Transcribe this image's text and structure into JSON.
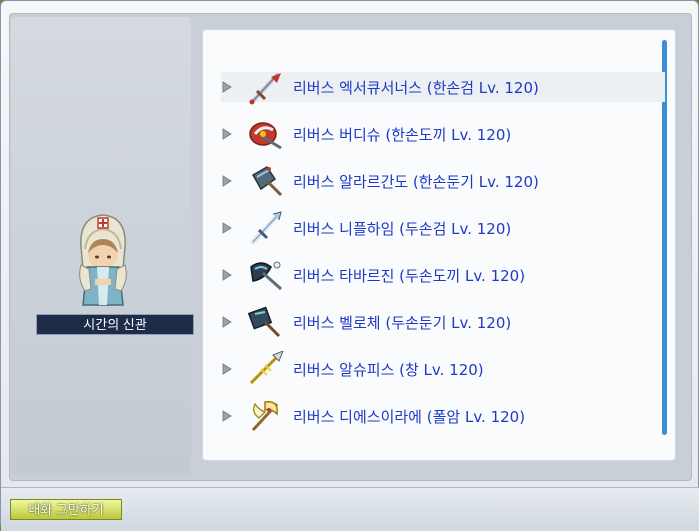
{
  "npc": {
    "name": "시간의 신관",
    "sprite": "hooded-priest-npc"
  },
  "options": [
    {
      "label": "리버스 엑서큐서너스 (한손검 Lv. 120)",
      "icon": "one-handed-sword-icon",
      "highlighted": true
    },
    {
      "label": "리버스 버디슈 (한손도끼 Lv. 120)",
      "icon": "one-handed-axe-icon",
      "highlighted": false
    },
    {
      "label": "리버스 알라르간도 (한손둔기 Lv. 120)",
      "icon": "one-handed-blunt-icon",
      "highlighted": false
    },
    {
      "label": "리버스 니플하임 (두손검 Lv. 120)",
      "icon": "two-handed-sword-icon",
      "highlighted": false
    },
    {
      "label": "리버스 타바르진 (두손도끼 Lv. 120)",
      "icon": "two-handed-axe-icon",
      "highlighted": false
    },
    {
      "label": "리버스 벨로체 (두손둔기 Lv. 120)",
      "icon": "two-handed-blunt-icon",
      "highlighted": false
    },
    {
      "label": "리버스 알슈피스 (창 Lv. 120)",
      "icon": "spear-icon",
      "highlighted": false
    },
    {
      "label": "리버스 디에스이라에 (폴암 Lv. 120)",
      "icon": "polearm-icon",
      "highlighted": false
    }
  ],
  "footer": {
    "end_chat_label": "대화 그만하기"
  },
  "colors": {
    "option_text": "#1d39c7",
    "scroll_thumb": "#3a8fd6",
    "name_plate": "#1f2c47",
    "end_button": "#c9d64a"
  }
}
